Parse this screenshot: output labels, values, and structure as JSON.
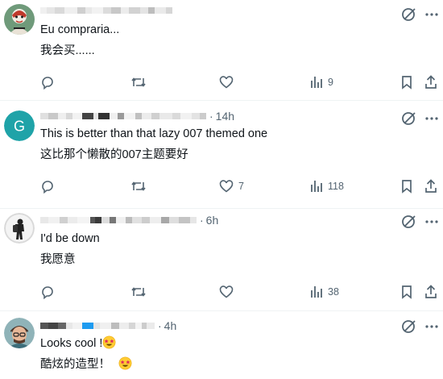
{
  "posts": [
    {
      "time": "",
      "text_original": "Eu compraria...",
      "text_translation": "我会买......",
      "reply_count": "",
      "repost_count": "",
      "like_count": "",
      "view_count": "9",
      "avatar_letter": "",
      "avatar_color": "#6a8f74"
    },
    {
      "time": "14h",
      "text_original": "This is better than that lazy 007 themed one",
      "text_translation": "这比那个懒散的007主题要好",
      "reply_count": "",
      "repost_count": "",
      "like_count": "7",
      "view_count": "118",
      "avatar_letter": "G",
      "avatar_color": "#1da1a6"
    },
    {
      "time": "6h",
      "text_original": "I'd be down",
      "text_translation": "我愿意",
      "reply_count": "",
      "repost_count": "",
      "like_count": "",
      "view_count": "38",
      "avatar_letter": "",
      "avatar_color": "#cfcfcf"
    },
    {
      "time": "4h",
      "text_original": "Looks cool !",
      "text_translation": "酷炫的造型！",
      "reply_count": "",
      "repost_count": "",
      "like_count": "",
      "view_count": "",
      "avatar_letter": "",
      "avatar_color": "#7aa0a8"
    }
  ],
  "icons": {
    "reply": "reply-icon",
    "repost": "repost-icon",
    "like": "like-icon",
    "views": "views-icon",
    "bookmark": "bookmark-icon",
    "share": "share-icon",
    "grok": "grok-icon",
    "more": "more-icon",
    "emoji": "star-struck-emoji"
  },
  "colors": {
    "text": "#0f1419",
    "secondary": "#536471",
    "divider": "#eff3f4",
    "verified": "#1d9bf0"
  }
}
